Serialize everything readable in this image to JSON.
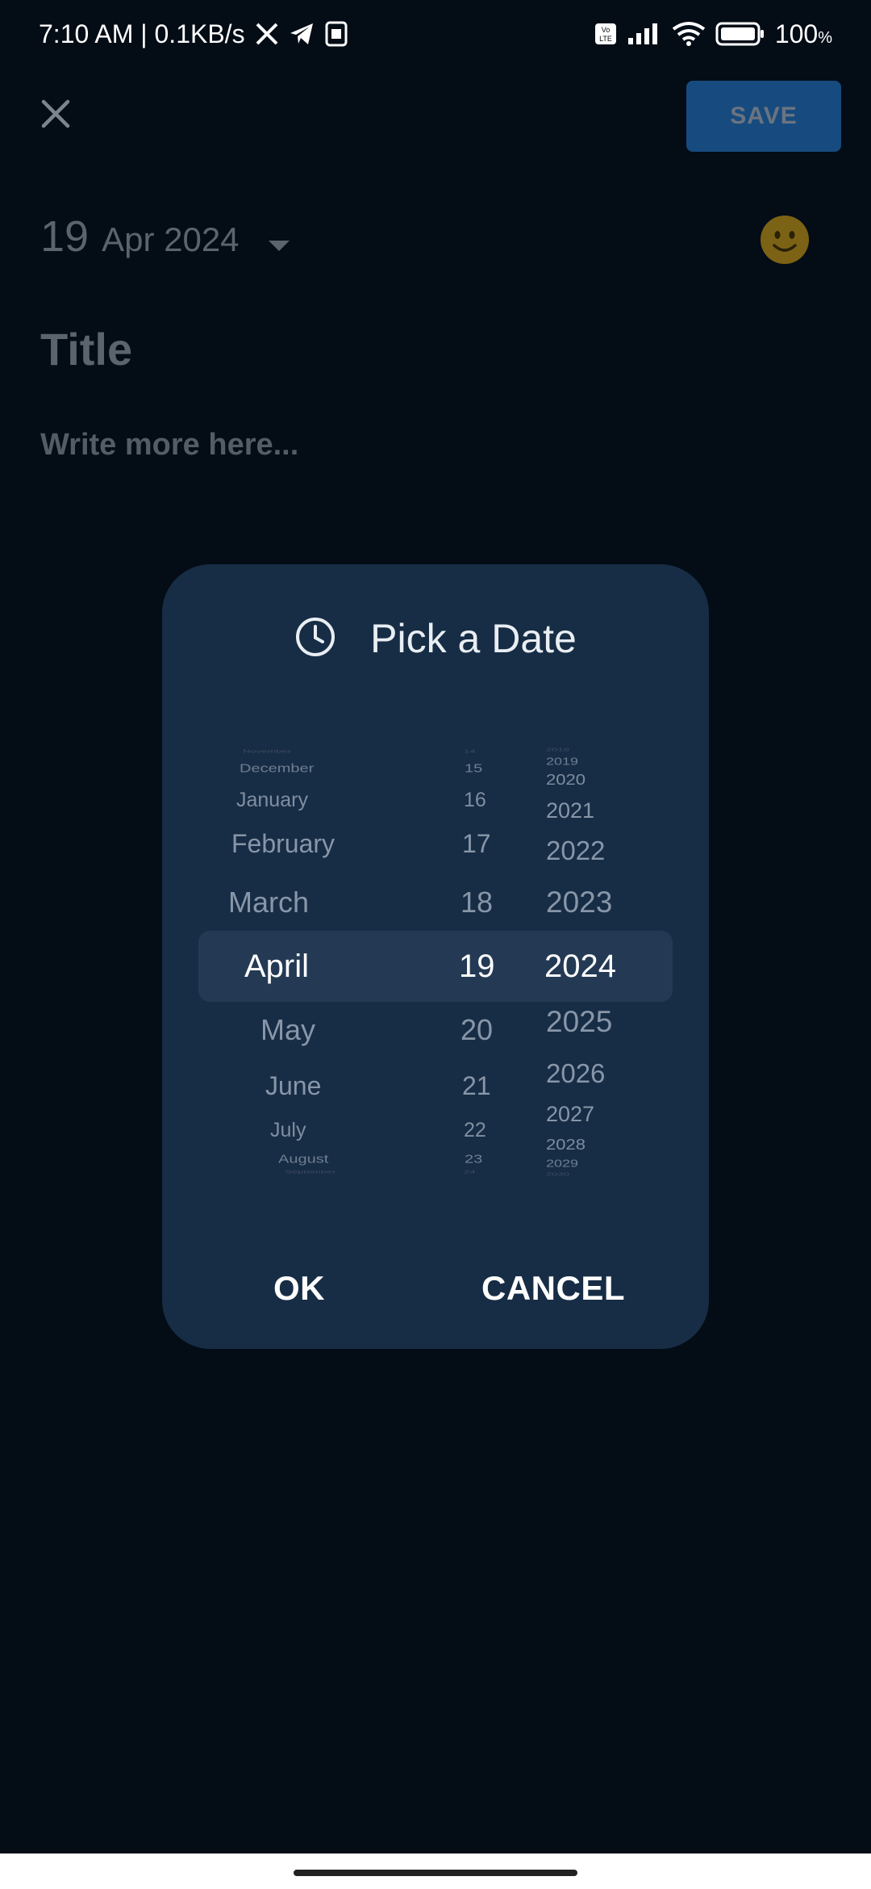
{
  "status_bar": {
    "time_speed": "7:10 AM | 0.1KB/s",
    "battery": "100",
    "battery_unit": "%",
    "icons": [
      "x-icon",
      "telegram-icon",
      "sim-icon",
      "volte-icon",
      "signal-icon",
      "wifi-icon",
      "battery-icon"
    ]
  },
  "app_bar": {
    "save_label": "SAVE",
    "close_icon": "close-icon"
  },
  "entry": {
    "day": "19",
    "month_year": "Apr 2024",
    "title_placeholder": "Title",
    "body_placeholder": "Write more here...",
    "mood_icon": "smiley-icon"
  },
  "dialog": {
    "title": "Pick a Date",
    "icon": "clock-icon",
    "ok_label": "OK",
    "cancel_label": "CANCEL",
    "months": [
      "November",
      "December",
      "January",
      "February",
      "March",
      "April",
      "May",
      "June",
      "July",
      "August",
      "September"
    ],
    "days": [
      "14",
      "15",
      "16",
      "17",
      "18",
      "19",
      "20",
      "21",
      "22",
      "23",
      "24"
    ],
    "years": [
      "2018",
      "2019",
      "2020",
      "2021",
      "2022",
      "2023",
      "2024",
      "2025",
      "2026",
      "2027",
      "2028",
      "2029",
      "2030"
    ],
    "selected": {
      "month": "April",
      "day": "19",
      "year": "2024"
    }
  },
  "colors": {
    "background": "#040c16",
    "dialog": "#172d45",
    "save_button": "#174b7f",
    "highlight": "#243a54"
  }
}
